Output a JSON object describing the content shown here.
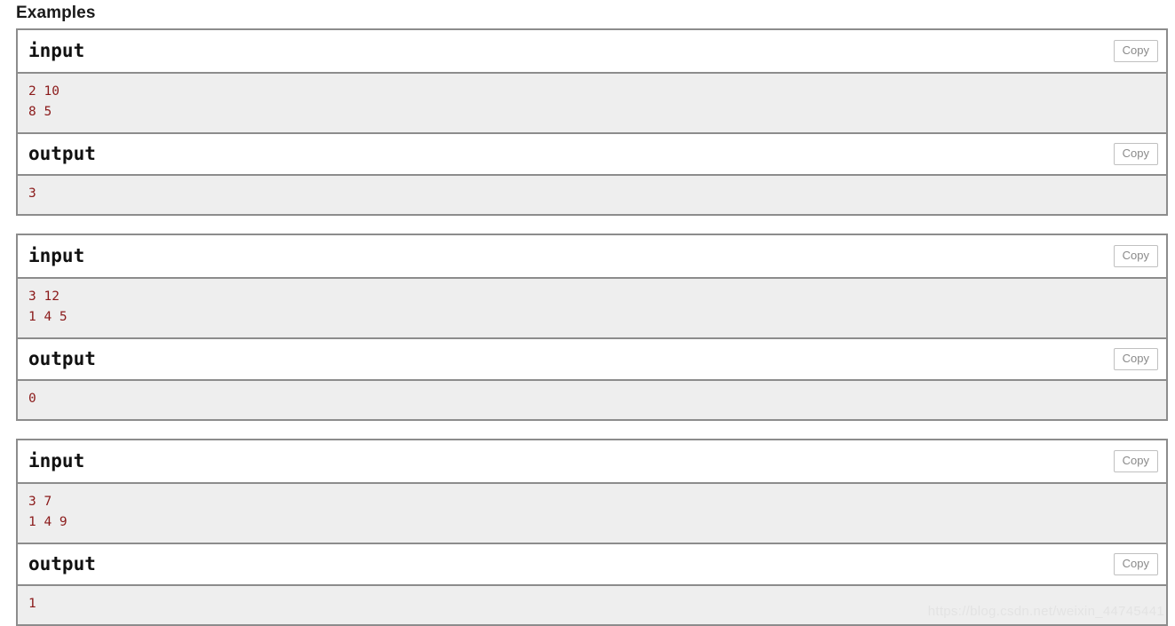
{
  "section": {
    "title": "Examples"
  },
  "labels": {
    "input": "input",
    "output": "output",
    "copy": "Copy"
  },
  "examples": [
    {
      "input_label": "input",
      "input_text": "2 10\n8 5",
      "input_copy": "Copy",
      "output_label": "output",
      "output_text": "3",
      "output_copy": "Copy"
    },
    {
      "input_label": "input",
      "input_text": "3 12\n1 4 5",
      "input_copy": "Copy",
      "output_label": "output",
      "output_text": "0",
      "output_copy": "Copy"
    },
    {
      "input_label": "input",
      "input_text": "3 7\n1 4 9",
      "input_copy": "Copy",
      "output_label": "output",
      "output_text": "1",
      "output_copy": "Copy"
    }
  ],
  "watermark": {
    "text": "https://blog.csdn.net/weixin_44745441"
  },
  "colors": {
    "border": "#8c8c8c",
    "body_background": "#eeeeee",
    "data_text": "#8b1a1a",
    "copy_text": "#8a8a8a",
    "watermark_text": "#e3e3e3"
  }
}
